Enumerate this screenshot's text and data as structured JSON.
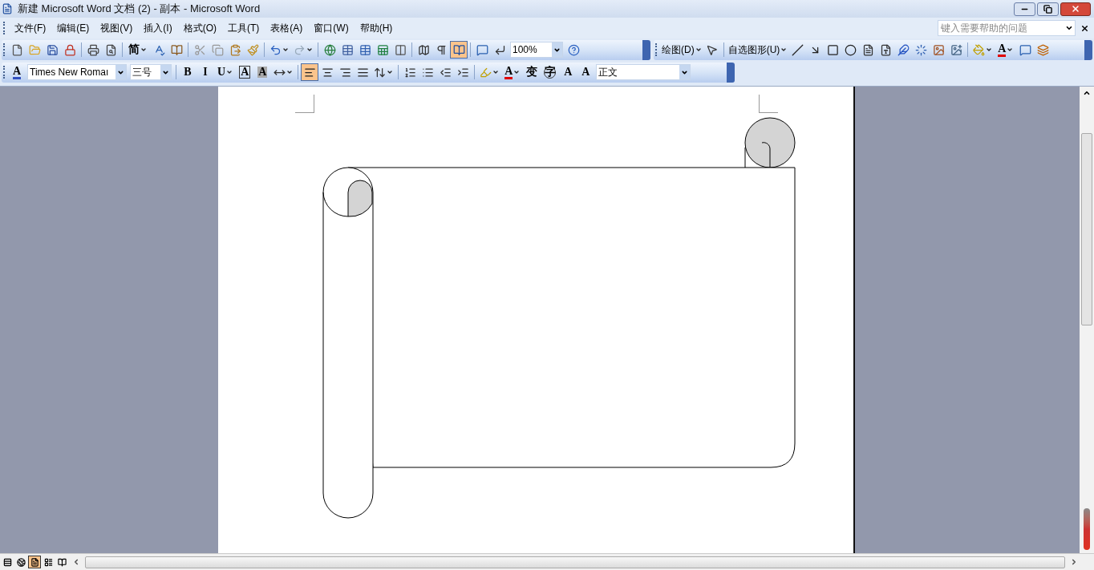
{
  "window": {
    "title": "新建 Microsoft Word 文档 (2) - 副本 - Microsoft Word"
  },
  "menu": [
    {
      "label": "文件(F)"
    },
    {
      "label": "编辑(E)"
    },
    {
      "label": "视图(V)"
    },
    {
      "label": "插入(I)"
    },
    {
      "label": "格式(O)"
    },
    {
      "label": "工具(T)"
    },
    {
      "label": "表格(A)"
    },
    {
      "label": "窗口(W)"
    },
    {
      "label": "帮助(H)"
    }
  ],
  "help_box": {
    "placeholder": "键入需要帮助的问题"
  },
  "standard_toolbar": [
    {
      "kind": "icon",
      "selected": false
    },
    {
      "kind": "icon",
      "selected": false
    },
    {
      "kind": "icon",
      "selected": false
    },
    {
      "kind": "icon",
      "selected": false
    },
    {
      "kind": "separator"
    },
    {
      "kind": "icon",
      "selected": false
    },
    {
      "kind": "icon",
      "selected": false
    },
    {
      "kind": "separator"
    },
    {
      "kind": "text",
      "label": "简",
      "menu": true,
      "selected": false
    },
    {
      "kind": "icon",
      "selected": false
    },
    {
      "kind": "icon",
      "selected": false
    },
    {
      "kind": "separator"
    },
    {
      "kind": "icon",
      "selected": false
    },
    {
      "kind": "icon",
      "selected": false
    },
    {
      "kind": "icon",
      "selected": false
    },
    {
      "kind": "icon",
      "selected": false
    },
    {
      "kind": "separator"
    },
    {
      "kind": "icon",
      "menu": true,
      "selected": false
    },
    {
      "kind": "icon",
      "menu": true,
      "selected": false
    },
    {
      "kind": "separator"
    },
    {
      "kind": "icon",
      "selected": false
    },
    {
      "kind": "icon",
      "selected": false
    },
    {
      "kind": "icon",
      "selected": false
    },
    {
      "kind": "icon",
      "selected": false
    },
    {
      "kind": "icon",
      "selected": false
    },
    {
      "kind": "separator"
    },
    {
      "kind": "icon",
      "selected": false
    },
    {
      "kind": "icon",
      "selected": false
    },
    {
      "kind": "icon",
      "selected": true
    },
    {
      "kind": "separator"
    },
    {
      "kind": "icon",
      "selected": false
    },
    {
      "kind": "icon",
      "selected": false
    },
    {
      "kind": "dropdown",
      "value": "100%"
    },
    {
      "kind": "icon",
      "selected": false
    }
  ],
  "drawing_toolbar": [
    {
      "kind": "textmenu",
      "label": "绘图(D)"
    },
    {
      "kind": "icon",
      "selected": false
    },
    {
      "kind": "separator"
    },
    {
      "kind": "textmenu",
      "label": "自选图形(U)"
    },
    {
      "kind": "icon",
      "selected": false
    },
    {
      "kind": "icon",
      "selected": false
    },
    {
      "kind": "icon",
      "selected": false
    },
    {
      "kind": "icon",
      "selected": false
    },
    {
      "kind": "icon",
      "selected": false
    },
    {
      "kind": "icon",
      "selected": false
    },
    {
      "kind": "icon",
      "selected": false
    },
    {
      "kind": "icon",
      "selected": false
    },
    {
      "kind": "icon",
      "selected": false
    },
    {
      "kind": "icon",
      "selected": false
    },
    {
      "kind": "separator"
    },
    {
      "kind": "icon",
      "menu": true,
      "selected": false
    },
    {
      "kind": "text",
      "label": "A",
      "menu": true,
      "selected": false
    },
    {
      "kind": "icon",
      "selected": false
    },
    {
      "kind": "icon",
      "selected": false
    }
  ],
  "formatting_toolbar": [
    {
      "kind": "text",
      "label": "A",
      "selected": false
    },
    {
      "kind": "dropdown",
      "value": "Times New Romaı"
    },
    {
      "kind": "dropdown",
      "value": "三号"
    },
    {
      "kind": "separator"
    },
    {
      "kind": "text",
      "label": "B",
      "selected": false
    },
    {
      "kind": "text",
      "label": "I",
      "selected": false
    },
    {
      "kind": "text",
      "label": "U",
      "menu": true,
      "selected": false
    },
    {
      "kind": "text",
      "label": "A",
      "selected": false
    },
    {
      "kind": "text",
      "label": "A",
      "selected": false
    },
    {
      "kind": "icon",
      "menu": true,
      "selected": false
    },
    {
      "kind": "separator"
    },
    {
      "kind": "icon",
      "selected": true
    },
    {
      "kind": "icon",
      "selected": false
    },
    {
      "kind": "icon",
      "selected": false
    },
    {
      "kind": "icon",
      "selected": false
    },
    {
      "kind": "icon",
      "menu": true,
      "selected": false
    },
    {
      "kind": "separator"
    },
    {
      "kind": "icon",
      "selected": false
    },
    {
      "kind": "icon",
      "selected": false
    },
    {
      "kind": "icon",
      "selected": false
    },
    {
      "kind": "icon",
      "selected": false
    },
    {
      "kind": "separator"
    },
    {
      "kind": "icon",
      "menu": true,
      "selected": false
    },
    {
      "kind": "text",
      "label": "A",
      "menu": true,
      "selected": false
    },
    {
      "kind": "text",
      "label": "变",
      "selected": false
    },
    {
      "kind": "text",
      "label": "字",
      "selected": false
    },
    {
      "kind": "text",
      "label": "A",
      "selected": false
    },
    {
      "kind": "text",
      "label": "A",
      "selected": false
    },
    {
      "kind": "dropdown",
      "value": "正文"
    }
  ],
  "view_buttons": [
    {
      "selected": false
    },
    {
      "selected": false
    },
    {
      "selected": true
    },
    {
      "selected": false
    },
    {
      "selected": false
    }
  ]
}
